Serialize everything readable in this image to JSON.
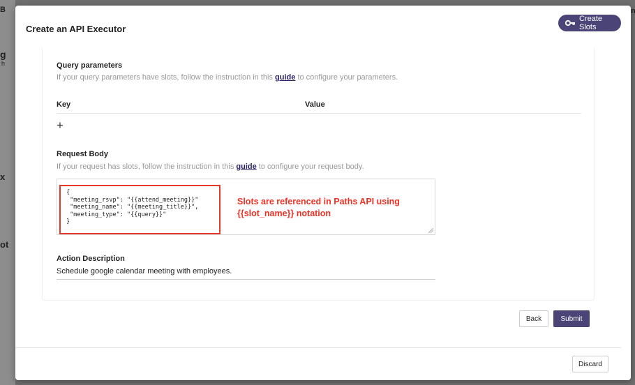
{
  "background": {
    "fragments": [
      "B",
      "g",
      "h",
      "x",
      "ot",
      "n"
    ]
  },
  "modal": {
    "title": "Create an API Executor",
    "create_slots_label": "Create Slots"
  },
  "query_parameters": {
    "title": "Query parameters",
    "help_prefix": "If your query parameters have slots, follow the instruction in this ",
    "help_link": "guide",
    "help_suffix": " to configure your parameters.",
    "key_header": "Key",
    "value_header": "Value",
    "add_label": "+"
  },
  "request_body": {
    "title": "Request Body",
    "help_prefix": "If your request has slots, follow the instruction in this ",
    "help_link": "guide",
    "help_suffix": " to configure your request body.",
    "code": "{\n \"meeting_rsvp\": \"{{attend_meeting}}\"\n \"meeting_name\": \"{{meeting_title}}\",\n \"meeting_type\": \"{{query}}\"\n}",
    "annotation": "Slots are referenced in Paths API using {{slot_name}} notation"
  },
  "action_description": {
    "title": "Action Description",
    "value": "Schedule google calendar meeting with employees."
  },
  "buttons": {
    "back": "Back",
    "submit": "Submit",
    "discard": "Discard"
  },
  "colors": {
    "primary": "#4b4577",
    "annotation_red": "#ee3124",
    "link": "#2a2466"
  }
}
